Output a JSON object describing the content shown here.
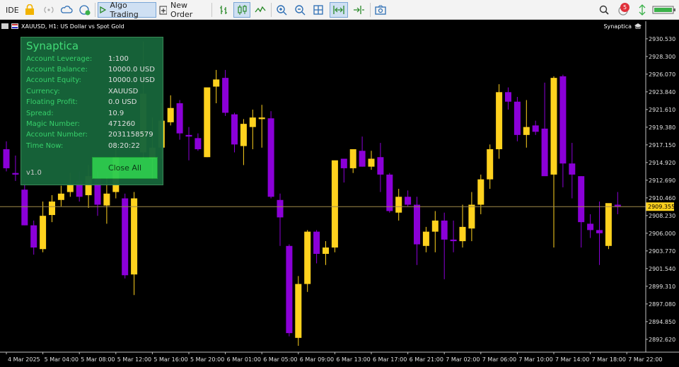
{
  "toolbar": {
    "ide_label": "IDE",
    "algo_label": "Algo Trading",
    "new_order_label": "New Order",
    "notification_count": "5"
  },
  "chart_header": {
    "title": "XAUUSD, H1:  US Dollar vs Spot Gold",
    "ea_name": "Synaptica"
  },
  "panel": {
    "title": "Synaptica",
    "rows": [
      {
        "label": "Account Leverage:",
        "value": "1:100"
      },
      {
        "label": "Account Balance:",
        "value": "10000.0 USD"
      },
      {
        "label": "Account Equity:",
        "value": "10000.0 USD"
      },
      {
        "label": "Currency:",
        "value": "XAUUSD"
      },
      {
        "label": "Floating Profit:",
        "value": "0.0 USD"
      },
      {
        "label": "Spread:",
        "value": "10.9"
      },
      {
        "label": "Magic Number:",
        "value": "471260"
      },
      {
        "label": "Account Number:",
        "value": "2031158579"
      },
      {
        "label": "Time Now:",
        "value": "08:20:22"
      }
    ],
    "version": "v1.0",
    "close_all_label": "Close All"
  },
  "colors": {
    "bull": "#ffd21e",
    "bear": "#8b00d8",
    "background": "#000000",
    "current_price_line": "#a08a4a",
    "panel_bg": "#17653a",
    "panel_text": "#39d86f",
    "close_button": "#2ecc4f"
  },
  "chart_data": {
    "type": "candlestick",
    "symbol": "XAUUSD",
    "timeframe": "H1",
    "current_price": "2909.355",
    "ylim": [
      2891.0,
      2931.5
    ],
    "y_ticks": [
      "2930.530",
      "2928.300",
      "2926.070",
      "2923.840",
      "2921.610",
      "2919.380",
      "2917.150",
      "2914.920",
      "2912.690",
      "2910.460",
      "2908.230",
      "2906.000",
      "2903.770",
      "2901.540",
      "2899.310",
      "2897.080",
      "2894.850",
      "2892.620"
    ],
    "x_ticks": [
      "4 Mar 2025",
      "5 Mar 04:00",
      "5 Mar 08:00",
      "5 Mar 12:00",
      "5 Mar 16:00",
      "5 Mar 20:00",
      "6 Mar 01:00",
      "6 Mar 05:00",
      "6 Mar 09:00",
      "6 Mar 13:00",
      "6 Mar 17:00",
      "6 Mar 21:00",
      "7 Mar 02:00",
      "7 Mar 06:00",
      "7 Mar 10:00",
      "7 Mar 14:00",
      "7 Mar 18:00",
      "7 Mar 22:00"
    ],
    "candles": [
      {
        "o": 2916.6,
        "h": 2917.6,
        "l": 2913.8,
        "c": 2914.2
      },
      {
        "o": 2913.6,
        "h": 2915.8,
        "l": 2912.6,
        "c": 2913.4
      },
      {
        "o": 2911.5,
        "h": 2912.8,
        "l": 2907.0,
        "c": 2907.0
      },
      {
        "o": 2907.0,
        "h": 2907.6,
        "l": 2903.3,
        "c": 2904.2
      },
      {
        "o": 2904.0,
        "h": 2910.0,
        "l": 2903.6,
        "c": 2908.2
      },
      {
        "o": 2908.3,
        "h": 2910.8,
        "l": 2907.4,
        "c": 2910.0
      },
      {
        "o": 2910.2,
        "h": 2912.0,
        "l": 2909.4,
        "c": 2911.0
      },
      {
        "o": 2911.2,
        "h": 2913.6,
        "l": 2910.6,
        "c": 2912.2
      },
      {
        "o": 2912.6,
        "h": 2913.8,
        "l": 2910.0,
        "c": 2910.6
      },
      {
        "o": 2910.8,
        "h": 2914.6,
        "l": 2909.2,
        "c": 2913.2
      },
      {
        "o": 2913.0,
        "h": 2913.8,
        "l": 2908.2,
        "c": 2909.6
      },
      {
        "o": 2909.5,
        "h": 2913.0,
        "l": 2907.2,
        "c": 2911.0
      },
      {
        "o": 2911.2,
        "h": 2917.2,
        "l": 2910.4,
        "c": 2915.6
      },
      {
        "o": 2910.4,
        "h": 2911.0,
        "l": 2900.3,
        "c": 2900.7
      },
      {
        "o": 2900.8,
        "h": 2911.2,
        "l": 2898.2,
        "c": 2910.4
      },
      {
        "o": 2916.2,
        "h": 2930.2,
        "l": 2915.4,
        "c": 2923.6
      },
      {
        "o": 2915.4,
        "h": 2920.6,
        "l": 2912.8,
        "c": 2916.8
      },
      {
        "o": 2916.8,
        "h": 2922.4,
        "l": 2915.4,
        "c": 2920.2
      },
      {
        "o": 2920.0,
        "h": 2923.4,
        "l": 2919.6,
        "c": 2921.8
      },
      {
        "o": 2922.4,
        "h": 2922.8,
        "l": 2917.8,
        "c": 2918.6
      },
      {
        "o": 2918.4,
        "h": 2919.4,
        "l": 2915.2,
        "c": 2918.2
      },
      {
        "o": 2918.0,
        "h": 2918.6,
        "l": 2916.4,
        "c": 2916.6
      },
      {
        "o": 2915.6,
        "h": 2920.8,
        "l": 2915.6,
        "c": 2924.4
      },
      {
        "o": 2924.5,
        "h": 2926.6,
        "l": 2922.4,
        "c": 2925.4
      },
      {
        "o": 2925.6,
        "h": 2926.6,
        "l": 2920.8,
        "c": 2921.2
      },
      {
        "o": 2921.0,
        "h": 2921.2,
        "l": 2916.2,
        "c": 2917.2
      },
      {
        "o": 2917.0,
        "h": 2920.4,
        "l": 2914.6,
        "c": 2919.8
      },
      {
        "o": 2919.4,
        "h": 2921.6,
        "l": 2916.6,
        "c": 2920.6
      },
      {
        "o": 2920.4,
        "h": 2922.2,
        "l": 2916.8,
        "c": 2920.6
      },
      {
        "o": 2920.5,
        "h": 2921.4,
        "l": 2910.4,
        "c": 2910.6
      },
      {
        "o": 2910.2,
        "h": 2911.0,
        "l": 2904.4,
        "c": 2908.0
      },
      {
        "o": 2904.4,
        "h": 2904.6,
        "l": 2893.0,
        "c": 2893.4
      },
      {
        "o": 2892.8,
        "h": 2900.6,
        "l": 2891.8,
        "c": 2899.6
      },
      {
        "o": 2899.6,
        "h": 2906.4,
        "l": 2898.6,
        "c": 2906.2
      },
      {
        "o": 2906.2,
        "h": 2906.4,
        "l": 2902.2,
        "c": 2903.4
      },
      {
        "o": 2903.4,
        "h": 2905.0,
        "l": 2902.0,
        "c": 2904.2
      },
      {
        "o": 2904.2,
        "h": 2914.6,
        "l": 2903.6,
        "c": 2915.2
      },
      {
        "o": 2915.4,
        "h": 2915.4,
        "l": 2912.4,
        "c": 2914.2
      },
      {
        "o": 2914.2,
        "h": 2916.6,
        "l": 2913.6,
        "c": 2916.6
      },
      {
        "o": 2916.4,
        "h": 2918.2,
        "l": 2914.4,
        "c": 2914.4
      },
      {
        "o": 2914.4,
        "h": 2916.4,
        "l": 2914.0,
        "c": 2915.4
      },
      {
        "o": 2915.6,
        "h": 2917.4,
        "l": 2911.2,
        "c": 2913.4
      },
      {
        "o": 2913.4,
        "h": 2913.6,
        "l": 2908.6,
        "c": 2908.8
      },
      {
        "o": 2908.6,
        "h": 2911.6,
        "l": 2907.6,
        "c": 2910.6
      },
      {
        "o": 2910.6,
        "h": 2911.4,
        "l": 2909.4,
        "c": 2909.6
      },
      {
        "o": 2909.6,
        "h": 2910.6,
        "l": 2902.0,
        "c": 2904.6
      },
      {
        "o": 2904.4,
        "h": 2906.8,
        "l": 2903.6,
        "c": 2906.2
      },
      {
        "o": 2906.2,
        "h": 2908.8,
        "l": 2903.6,
        "c": 2907.6
      },
      {
        "o": 2907.6,
        "h": 2908.6,
        "l": 2900.2,
        "c": 2905.2
      },
      {
        "o": 2905.2,
        "h": 2907.6,
        "l": 2903.6,
        "c": 2905.0
      },
      {
        "o": 2905.0,
        "h": 2909.6,
        "l": 2904.2,
        "c": 2906.8
      },
      {
        "o": 2906.6,
        "h": 2911.2,
        "l": 2905.0,
        "c": 2909.6
      },
      {
        "o": 2909.6,
        "h": 2913.4,
        "l": 2908.4,
        "c": 2912.8
      },
      {
        "o": 2912.8,
        "h": 2917.2,
        "l": 2911.6,
        "c": 2916.6
      },
      {
        "o": 2916.6,
        "h": 2924.8,
        "l": 2915.4,
        "c": 2923.8
      },
      {
        "o": 2923.8,
        "h": 2924.4,
        "l": 2921.6,
        "c": 2922.6
      },
      {
        "o": 2922.6,
        "h": 2923.2,
        "l": 2917.6,
        "c": 2918.4
      },
      {
        "o": 2918.4,
        "h": 2922.8,
        "l": 2916.8,
        "c": 2919.4
      },
      {
        "o": 2919.6,
        "h": 2920.2,
        "l": 2918.4,
        "c": 2918.8
      },
      {
        "o": 2919.2,
        "h": 2925.0,
        "l": 2914.4,
        "c": 2913.2
      },
      {
        "o": 2913.4,
        "h": 2925.8,
        "l": 2904.2,
        "c": 2925.6
      },
      {
        "o": 2925.8,
        "h": 2926.0,
        "l": 2911.8,
        "c": 2914.8
      },
      {
        "o": 2914.8,
        "h": 2917.4,
        "l": 2910.4,
        "c": 2913.4
      },
      {
        "o": 2913.2,
        "h": 2913.2,
        "l": 2904.2,
        "c": 2907.4
      },
      {
        "o": 2907.2,
        "h": 2908.4,
        "l": 2905.4,
        "c": 2906.4
      },
      {
        "o": 2906.4,
        "h": 2910.0,
        "l": 2902.0,
        "c": 2906.0
      },
      {
        "o": 2904.4,
        "h": 2909.4,
        "l": 2904.0,
        "c": 2909.8
      },
      {
        "o": 2909.6,
        "h": 2911.2,
        "l": 2908.4,
        "c": 2909.4
      }
    ]
  }
}
